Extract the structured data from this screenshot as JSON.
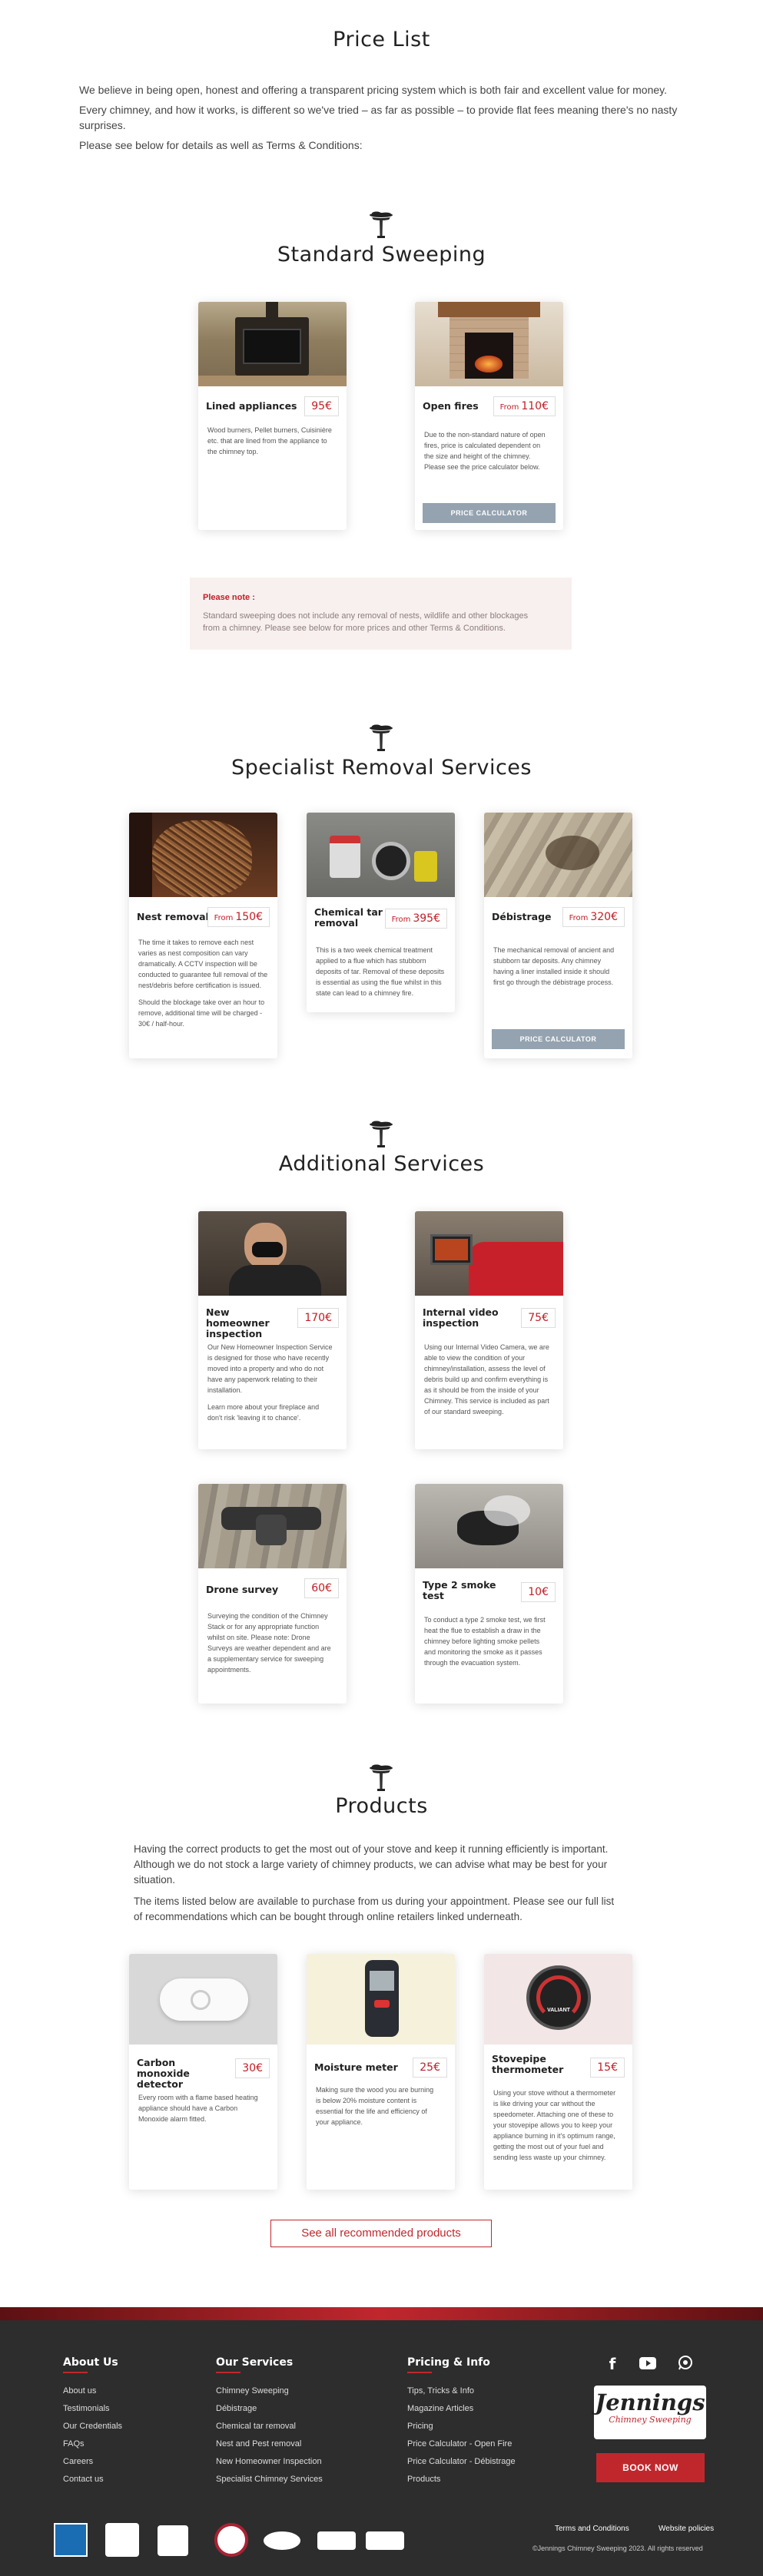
{
  "page_title": "Price List",
  "intro": [
    "We believe in being open, honest and offering a transparent pricing system which is both fair and excellent value for money.",
    "Every chimney, and how it works, is different so we've tried – as far as possible – to provide flat fees meaning there's no nasty surprises.",
    "Please see below for details as well as Terms & Conditions:"
  ],
  "standard": {
    "heading": "Standard Sweeping",
    "cards": [
      {
        "title": "Lined appliances",
        "price": "95€",
        "prefix": "",
        "desc": [
          "Wood burners, Pellet burners, Cuisinière etc. that are lined from the appliance to the chimney top."
        ]
      },
      {
        "title": "Open fires",
        "price": "110€",
        "prefix": "From",
        "desc": [
          "Due to the non-standard nature of open fires, price is calculated dependent on the size and height of the chimney. Please see the price calculator below."
        ],
        "button": "PRICE CALCULATOR"
      }
    ],
    "note_title": "Please note :",
    "note_text": "Standard sweeping does not include any removal of nests, wildlife and other blockages from a chimney. Please see below for more prices and other Terms & Conditions."
  },
  "specialist": {
    "heading": "Specialist Removal Services",
    "cards": [
      {
        "title": "Nest removal",
        "price": "150€",
        "prefix": "From",
        "desc": [
          "The time it takes to remove each nest varies as nest composition can vary dramatically. A CCTV inspection will be conducted to guarantee full removal of the nest/debris before certification is issued.",
          "Should the blockage take over an hour to remove, additional time will be charged - 30€ / half-hour."
        ]
      },
      {
        "title": "Chemical tar removal",
        "price": "395€",
        "prefix": "From",
        "desc": [
          "This is a two week chemical treatment applied to a flue which has stubborn deposits of tar. Removal of these deposits is essential as using the flue whilst in this state can lead to a chimney fire."
        ]
      },
      {
        "title": "Débistrage",
        "price": "320€",
        "prefix": "From",
        "desc": [
          "The mechanical removal of ancient and stubborn tar deposits. Any chimney having a liner installed inside it should first go through the débistrage process."
        ],
        "button": "PRICE CALCULATOR"
      }
    ]
  },
  "additional": {
    "heading": "Additional Services",
    "cards": [
      {
        "title": "New homeowner inspection",
        "price": "170€",
        "desc": [
          "Our New Homeowner Inspection Service is designed for those who have recently moved into a property and who do not have any paperwork relating to their installation.",
          "Learn more about your fireplace and don't risk 'leaving it to chance'."
        ]
      },
      {
        "title": "Internal video inspection",
        "price": "75€",
        "desc": [
          "Using our Internal Video Camera, we are able to view the condition of your chimney/installation, assess the level of debris build up and confirm everything is as it should be from the inside of your Chimney. This service is included as part of our standard sweeping."
        ]
      },
      {
        "title": "Drone survey",
        "price": "60€",
        "desc": [
          "Surveying the condition of the Chimney Stack or for any appropriate function whilst on site. Please note: Drone Surveys are weather dependent and are a supplementary service for sweeping appointments."
        ]
      },
      {
        "title": "Type 2 smoke test",
        "price": "10€",
        "desc": [
          "To conduct a type 2 smoke test, we first heat the flue to establish a draw in the chimney before lighting smoke pellets and monitoring the smoke as it passes through the evacuation system."
        ]
      }
    ]
  },
  "products": {
    "heading": "Products",
    "intro": [
      "Having the correct products to get the most out of your stove and keep it running efficiently is important. Although we do not stock a large variety of chimney products, we can advise what may be best for your situation.",
      "The items listed below are available to purchase from us during your appointment. Please see our full list of recommendations which can be bought through online retailers linked underneath."
    ],
    "cards": [
      {
        "title": "Carbon monoxide detector",
        "price": "30€",
        "desc": [
          "Every room with a flame based heating appliance should have a Carbon Monoxide alarm fitted."
        ]
      },
      {
        "title": "Moisture meter",
        "price": "25€",
        "desc": [
          "Making sure the wood you are burning is below 20% moisture content is essential for the life and efficiency of your appliance."
        ]
      },
      {
        "title": "Stovepipe thermometer",
        "price": "15€",
        "desc": [
          "Using your stove without a thermometer is like driving your car without the speedometer. Attaching one of these to your stovepipe allows you to keep your appliance burning in it's optimum range, getting the most out of your fuel and sending less waste up your chimney."
        ]
      }
    ],
    "thermo_brand": "VALIANT",
    "see_all": "See all recommended products"
  },
  "footer": {
    "about": {
      "title": "About Us",
      "links": [
        "About us",
        "Testimonials",
        "Our Credentials",
        "FAQs",
        "Careers",
        "Contact us"
      ]
    },
    "services": {
      "title": "Our Services",
      "links": [
        "Chimney Sweeping",
        "Débistrage",
        "Chemical tar removal",
        "Nest and Pest removal",
        "New Homeowner Inspection",
        "Specialist Chimney Services"
      ]
    },
    "pricing": {
      "title": "Pricing & Info",
      "links": [
        "Tips, Tricks & Info",
        "Magazine Articles",
        "Pricing",
        "Price Calculator - Open Fire",
        "Price Calculator - Débistrage",
        "Products"
      ]
    },
    "logo_text": "Jennings",
    "logo_sub": "Chimney Sweeping",
    "book": "BOOK NOW",
    "terms": "Terms and Conditions",
    "privacy": "Website policies",
    "copyright": "©Jennings Chimney Sweeping 2023. All rights reserved",
    "social": [
      "facebook-icon",
      "youtube-icon",
      "whatsapp-icon"
    ]
  },
  "colors": {
    "accent": "#c01f27",
    "button": "#95a3b0",
    "footer": "#2d2d2d",
    "note_bg": "#f7f0ef"
  }
}
